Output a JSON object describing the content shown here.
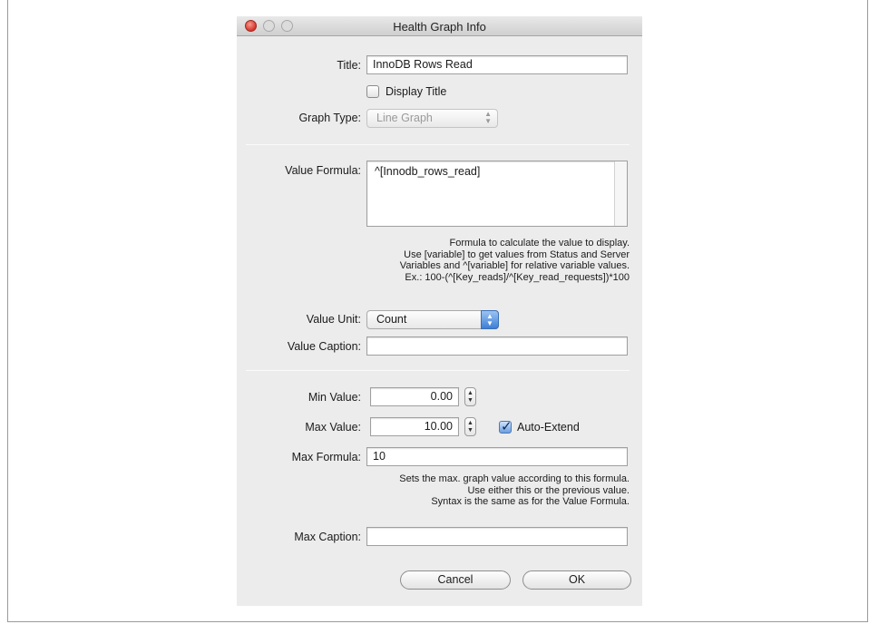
{
  "window": {
    "title": "Health Graph Info"
  },
  "title_field": {
    "label": "Title:",
    "value": "InnoDB Rows Read"
  },
  "display_title": {
    "label": "Display Title",
    "checked": false
  },
  "graph_type": {
    "label": "Graph Type:",
    "value": "Line Graph"
  },
  "value_formula": {
    "label": "Value Formula:",
    "value": "^[Innodb_rows_read]",
    "help": [
      "Formula to calculate the value to display.",
      "Use [variable] to get values from Status and Server",
      "Variables and ^[variable] for relative variable values.",
      "Ex.: 100-(^[Key_reads]/^[Key_read_requests])*100"
    ]
  },
  "value_unit": {
    "label": "Value Unit:",
    "value": "Count"
  },
  "value_caption": {
    "label": "Value Caption:",
    "value": ""
  },
  "min_value": {
    "label": "Min Value:",
    "value": "0.00"
  },
  "max_value": {
    "label": "Max Value:",
    "value": "10.00"
  },
  "auto_extend": {
    "label": "Auto-Extend",
    "checked": true
  },
  "max_formula": {
    "label": "Max Formula:",
    "value": "10",
    "help": [
      "Sets the max. graph value according to this formula.",
      "Use either this or the previous value.",
      "Syntax is the same as for the Value Formula."
    ]
  },
  "max_caption": {
    "label": "Max Caption:",
    "value": ""
  },
  "buttons": {
    "cancel": "Cancel",
    "ok": "OK"
  },
  "icons": {
    "stepper": "stepper-arrows-icon",
    "select": "popup-arrows-icon",
    "check": "checkmark-icon"
  }
}
